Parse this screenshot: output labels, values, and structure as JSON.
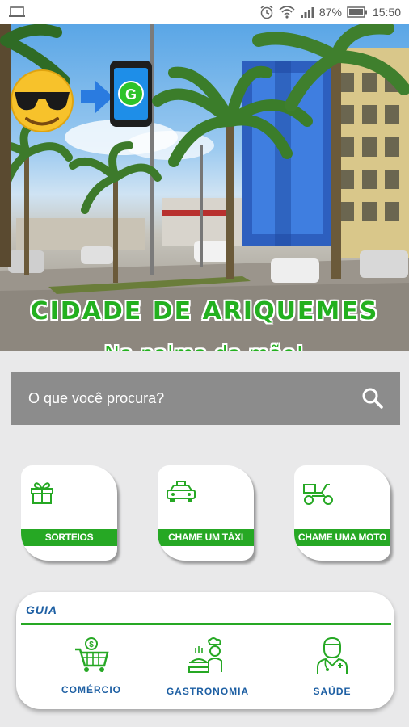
{
  "status_bar": {
    "battery_percent": "87%",
    "time": "15:50",
    "icons": [
      "laptop-icon",
      "alarm-icon",
      "wifi-icon",
      "signal-icon",
      "battery-icon"
    ]
  },
  "banner": {
    "title": "CIDADE DE ARIQUEMES",
    "subtitle": "Na palma da mão!",
    "emoji": "sunglasses-emoji",
    "phone_letter": "G"
  },
  "search": {
    "placeholder": "O que você procura?",
    "icon": "search-icon"
  },
  "cards": [
    {
      "label": "SORTEIOS",
      "icon": "gift-icon"
    },
    {
      "label": "CHAME UM TÁXI",
      "icon": "taxi-icon"
    },
    {
      "label": "CHAME UMA MOTO",
      "icon": "scooter-icon"
    }
  ],
  "guide": {
    "title": "GUIA",
    "items": [
      {
        "label": "COMÉRCIO",
        "icon": "shopping-cart-icon"
      },
      {
        "label": "GASTRONOMIA",
        "icon": "chef-icon"
      },
      {
        "label": "SAÚDE",
        "icon": "doctor-icon"
      }
    ]
  },
  "colors": {
    "green": "#26a824",
    "blue": "#1d5fa3",
    "search_bg": "#8c8c8c"
  }
}
